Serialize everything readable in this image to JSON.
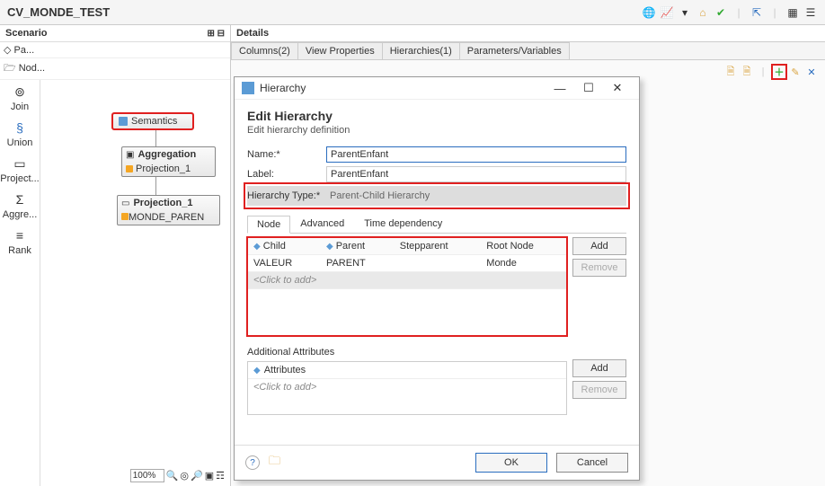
{
  "header": {
    "title": "CV_MONDE_TEST"
  },
  "scenario": {
    "label": "Scenario",
    "palette_tab": "Pa...",
    "nodes_tab": "Nod..."
  },
  "tools": {
    "join": "Join",
    "union": "Union",
    "project": "Project...",
    "aggre": "Aggre...",
    "rank": "Rank"
  },
  "nodes": {
    "semantics": "Semantics",
    "aggregation": "Aggregation",
    "aggregation_sub": "Projection_1",
    "projection1": "Projection_1",
    "projection1_sub": "MONDE_PAREN"
  },
  "zoom": {
    "value": "100%"
  },
  "details": {
    "label": "Details",
    "tabs": {
      "columns": "Columns(2)",
      "viewprops": "View Properties",
      "hierarchies": "Hierarchies(1)",
      "params": "Parameters/Variables"
    }
  },
  "modal": {
    "title": "Hierarchy",
    "heading": "Edit Hierarchy",
    "desc": "Edit hierarchy definition",
    "name_lbl": "Name:*",
    "name_val": "ParentEnfant",
    "label_lbl": "Label:",
    "label_val": "ParentEnfant",
    "htype_lbl": "Hierarchy Type:*",
    "htype_val": "Parent-Child Hierarchy",
    "subtabs": {
      "node": "Node",
      "advanced": "Advanced",
      "timedep": "Time dependency"
    },
    "grid_headers": {
      "child": "Child",
      "parent": "Parent",
      "stepparent": "Stepparent",
      "rootnode": "Root Node"
    },
    "grid_row": {
      "child": "VALEUR",
      "parent": "PARENT",
      "stepparent": "",
      "rootnode": "Monde"
    },
    "click_to_add": "<Click to add>",
    "add_btn": "Add",
    "remove_btn": "Remove",
    "add_attr_lbl": "Additional Attributes",
    "attr_header": "Attributes",
    "ok": "OK",
    "cancel": "Cancel"
  }
}
